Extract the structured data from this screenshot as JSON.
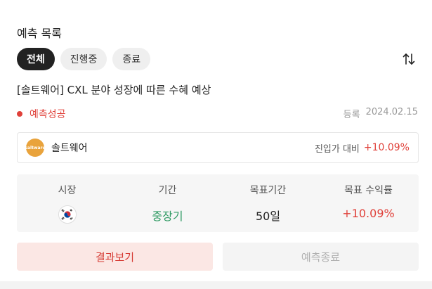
{
  "header": {
    "title": "예측 목록"
  },
  "tabs": [
    {
      "label": "전체",
      "active": true
    },
    {
      "label": "진행중",
      "active": false
    },
    {
      "label": "종료",
      "active": false
    }
  ],
  "sort_icon": "sort-arrows-icon",
  "prediction": {
    "headline": "[솔트웨어] CXL 분야 성장에 따른 수혜 예상",
    "status": "예측성공",
    "status_color": "#e0413a",
    "registered_label": "등록",
    "registered_date": "2024.02.15",
    "stock": {
      "name": "솔트웨어",
      "compare_label": "진입가 대비",
      "compare_value": "+10.09%"
    },
    "stats": {
      "market_label": "시장",
      "market_flag": "korea-flag-icon",
      "period_label": "기간",
      "period_value": "중장기",
      "target_period_label": "목표기간",
      "target_period_value": "50일",
      "target_return_label": "목표 수익률",
      "target_return_value": "+10.09%"
    },
    "buttons": {
      "result": "결과보기",
      "end": "예측종료"
    }
  },
  "colors": {
    "accent_red": "#e0413a",
    "green": "#2f9a63",
    "logo": "#e9a33c"
  }
}
